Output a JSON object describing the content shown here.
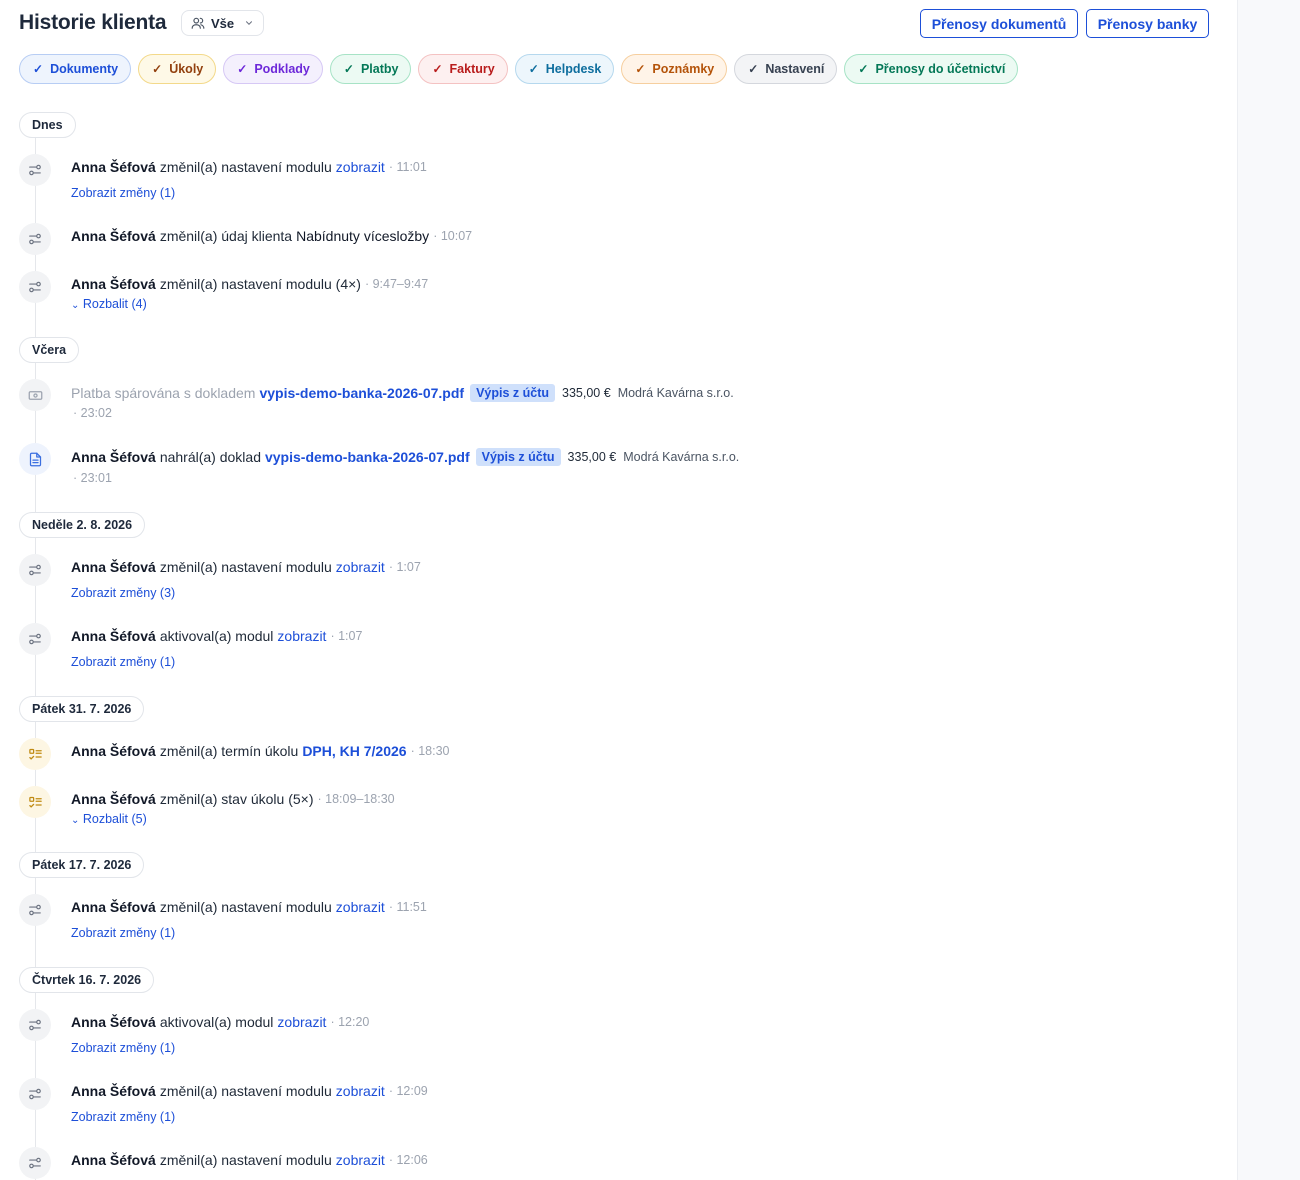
{
  "header": {
    "title": "Historie klienta",
    "scope_label": "Vše",
    "btn_docs": "Přenosy dokumentů",
    "btn_bank": "Přenosy banky"
  },
  "filters": [
    {
      "label": "Dokumenty",
      "color": "#1d4fd8",
      "bg": "#eef4fd",
      "border": "#b7cdf4"
    },
    {
      "label": "Úkoly",
      "color": "#92400e",
      "bg": "#fef9e7",
      "border": "#f3d98a"
    },
    {
      "label": "Podklady",
      "color": "#6d28d9",
      "bg": "#f4f0fd",
      "border": "#d6c8f5"
    },
    {
      "label": "Platby",
      "color": "#047857",
      "bg": "#ecfaf3",
      "border": "#a7e3c6"
    },
    {
      "label": "Faktury",
      "color": "#b91c1c",
      "bg": "#fdf0f0",
      "border": "#f4c2c2"
    },
    {
      "label": "Helpdesk",
      "color": "#0e6e9e",
      "bg": "#edf6fc",
      "border": "#b5d8ee"
    },
    {
      "label": "Poznámky",
      "color": "#b45309",
      "bg": "#fff4e8",
      "border": "#f6cf9f"
    },
    {
      "label": "Nastavení",
      "color": "#374151",
      "bg": "#f3f4f6",
      "border": "#d4d7dd"
    },
    {
      "label": "Přenosy do účetnictví",
      "color": "#047857",
      "bg": "#ecfaf3",
      "border": "#a7e3c6"
    }
  ],
  "days": {
    "d1": "Dnes",
    "d2": "Včera",
    "d3": "Neděle 2. 8. 2026",
    "d4": "Pátek 31. 7. 2026",
    "d5": "Pátek 17. 7. 2026",
    "d6": "Čtvrtek 16. 7. 2026"
  },
  "events": {
    "e1": {
      "actor": "Anna Šéfová",
      "action": "změnil(a) nastavení modulu",
      "link": "zobrazit",
      "time": "· 11:01",
      "sub": "Zobrazit změny (1)"
    },
    "e2": {
      "actor": "Anna Šéfová",
      "action": "změnil(a) údaj klienta",
      "target": "Nabídnuty vícesložby",
      "time": "· 10:07"
    },
    "e3": {
      "actor": "Anna Šéfová",
      "action": "změnil(a) nastavení modulu (4×)",
      "time": "· 9:47–9:47",
      "sub": "Rozbalit (4)"
    },
    "e4": {
      "text": "Platba spárována s dokladem",
      "link": "vypis-demo-banka-2026-07.pdf",
      "badge": "Výpis z účtu",
      "amount": "335,00 €",
      "payee": "Modrá Kavárna s.r.o.",
      "time": "· 23:02"
    },
    "e5": {
      "actor": "Anna Šéfová",
      "action": "nahrál(a) doklad",
      "link": "vypis-demo-banka-2026-07.pdf",
      "badge": "Výpis z účtu",
      "amount": "335,00 €",
      "payee": "Modrá Kavárna s.r.o.",
      "time": "· 23:01"
    },
    "e6": {
      "actor": "Anna Šéfová",
      "action": "změnil(a) nastavení modulu",
      "link": "zobrazit",
      "time": "· 1:07",
      "sub": "Zobrazit změny (3)"
    },
    "e7": {
      "actor": "Anna Šéfová",
      "action": "aktivoval(a) modul",
      "link": "zobrazit",
      "time": "· 1:07",
      "sub": "Zobrazit změny (1)"
    },
    "e8": {
      "actor": "Anna Šéfová",
      "action": "změnil(a) termín úkolu",
      "link": "DPH, KH 7/2026",
      "time": "· 18:30"
    },
    "e9": {
      "actor": "Anna Šéfová",
      "action": "změnil(a) stav úkolu (5×)",
      "time": "· 18:09–18:30",
      "sub": "Rozbalit (5)"
    },
    "e10": {
      "actor": "Anna Šéfová",
      "action": "změnil(a) nastavení modulu",
      "link": "zobrazit",
      "time": "· 11:51",
      "sub": "Zobrazit změny (1)"
    },
    "e11": {
      "actor": "Anna Šéfová",
      "action": "aktivoval(a) modul",
      "link": "zobrazit",
      "time": "· 12:20",
      "sub": "Zobrazit změny (1)"
    },
    "e12": {
      "actor": "Anna Šéfová",
      "action": "změnil(a) nastavení modulu",
      "link": "zobrazit",
      "time": "· 12:09",
      "sub": "Zobrazit změny (1)"
    },
    "e13": {
      "actor": "Anna Šéfová",
      "action": "změnil(a) nastavení modulu",
      "link": "zobrazit",
      "time": "· 12:06"
    }
  },
  "icons": {
    "settings": "sliders-icon",
    "task": "checklist-icon",
    "payment": "banknote-icon",
    "document": "document-icon",
    "check": "check-icon",
    "users": "users-icon",
    "chevron": "chevron-down-icon"
  }
}
